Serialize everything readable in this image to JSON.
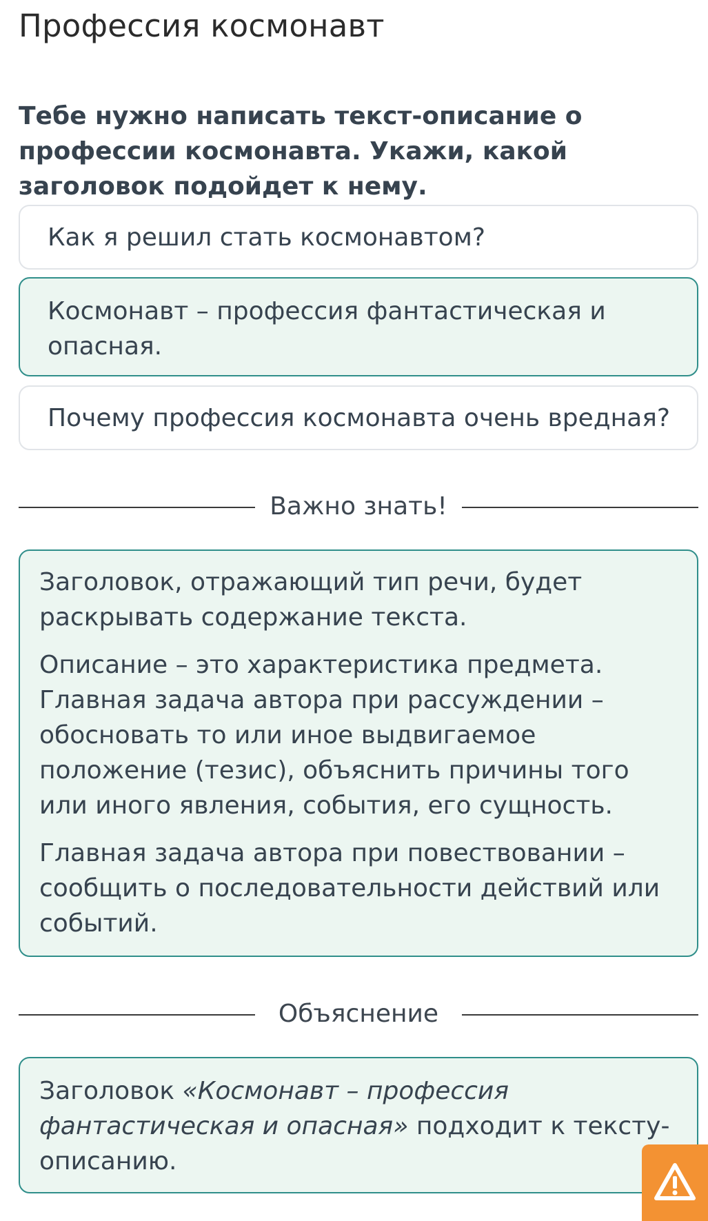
{
  "page": {
    "title": "Профессия космонавт"
  },
  "question": {
    "text": "Тебе нужно написать текст-описание о профессии космонавта. Укажи, какой заголовок подойдет к нему."
  },
  "options": [
    {
      "label": "Как я решил стать космонавтом?",
      "selected": false
    },
    {
      "label": "Космонавт – профессия фантастическая и опасная.",
      "selected": true
    },
    {
      "label": "Почему профессия космонавта очень вредная?",
      "selected": false
    }
  ],
  "important": {
    "heading": "Важно знать!",
    "paragraphs": [
      "Заголовок, отражающий тип речи, будет раскрывать содержание текста.",
      "Описание – это характеристика предмета. Главная задача автора при рассуждении – обосновать то или иное выдвигаемое положение (тезис), объяснить причины того или иного явления, события, его сущность.",
      "Главная задача автора при повествовании – сообщить о последовательности действий или событий."
    ]
  },
  "explanation": {
    "heading": "Объяснение",
    "prefix": "Заголовок ",
    "quoted_title": "«Космонавт – профессия фантастическая и опасная»",
    "suffix": " подходит к тексту-описанию."
  },
  "report_button": {
    "icon": "warning-icon",
    "color": "#f39233"
  },
  "colors": {
    "accent": "#2f8e8a",
    "selected_background": "#ecf6f1"
  }
}
